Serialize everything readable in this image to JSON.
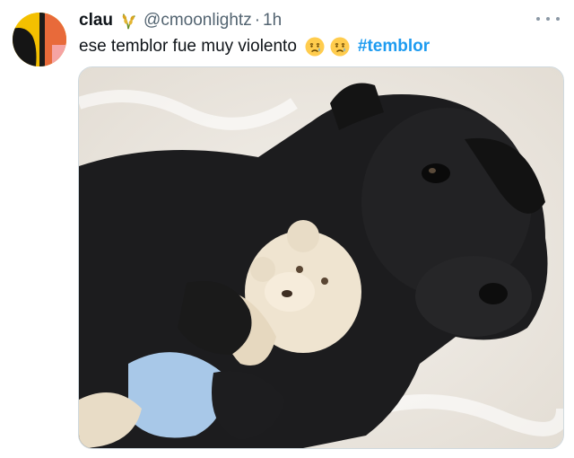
{
  "tweet": {
    "display_name": "clau",
    "handle": "@cmoonlightz",
    "separator": "·",
    "time": "1h",
    "text": "ese temblor fue muy violento",
    "emojis": [
      "crying-face-emoji",
      "crying-face-emoji"
    ],
    "hashtag": "#temblor",
    "name_icon": "wheat-icon",
    "more_icon": "more-options-icon",
    "media": {
      "description_kind": "photo",
      "subject_icons": [
        "black-puppy",
        "teddy-bear"
      ]
    }
  },
  "colors": {
    "text": "#0f1419",
    "secondary": "#536471",
    "link": "#1d9bf0",
    "border": "#cfd9de"
  }
}
